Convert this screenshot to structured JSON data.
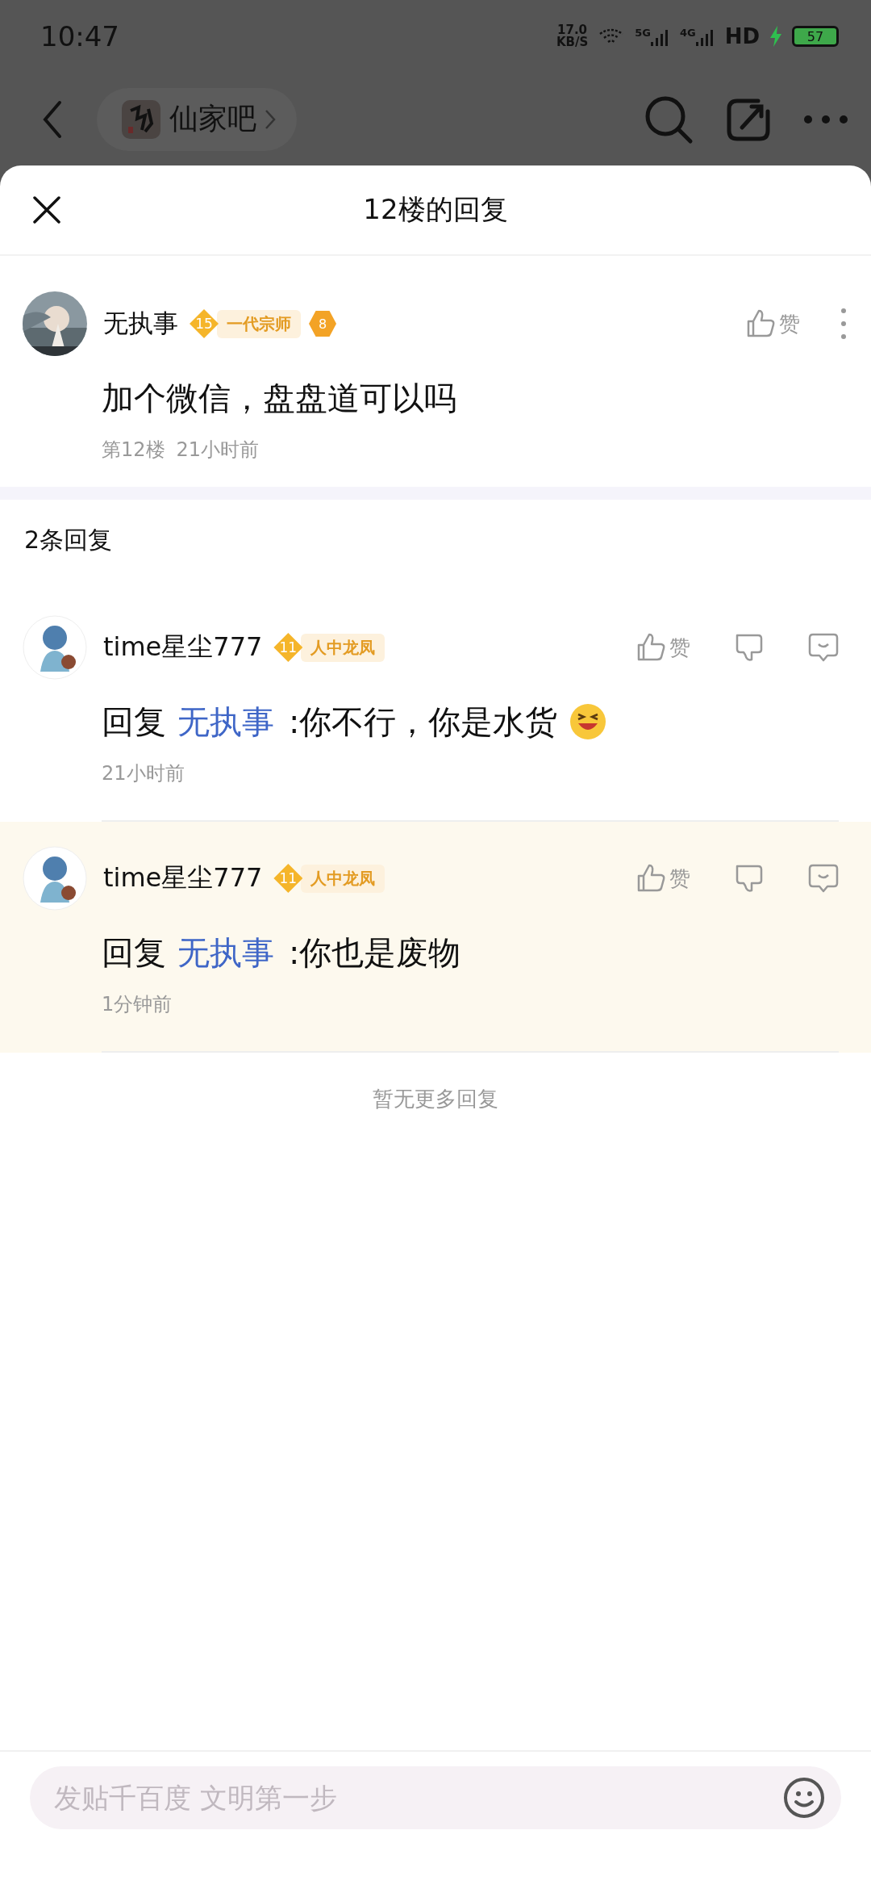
{
  "status_bar": {
    "time": "10:47",
    "net_speed": [
      "17.0",
      "KB/S"
    ],
    "signals": [
      "5G",
      "4G"
    ],
    "hd": "HD",
    "battery": "57",
    "charging": true
  },
  "nav": {
    "forum": "仙家吧"
  },
  "sheet": {
    "title": "12楼的回复"
  },
  "post": {
    "author": "无执事",
    "level": "15",
    "rank": "一代宗师",
    "badge": "8",
    "like": "赞",
    "content": "加个微信，盘盘道可以吗",
    "floor": "第12楼",
    "time": "21小时前"
  },
  "reply_count": "2条回复",
  "replies": [
    {
      "author": "time星尘777",
      "level": "11",
      "rank": "人中龙凤",
      "like": "赞",
      "prefix": "回复",
      "reply_to": "无执事",
      "text": ":你不行，你是水货",
      "emoji": true,
      "time": "21小时前",
      "highlighted": false
    },
    {
      "author": "time星尘777",
      "level": "11",
      "rank": "人中龙凤",
      "like": "赞",
      "prefix": "回复",
      "reply_to": "无执事",
      "text": ":你也是废物",
      "emoji": false,
      "time": "1分钟前",
      "highlighted": true
    }
  ],
  "end_note": "暂无更多回复",
  "composer": {
    "placeholder": "发贴千百度 文明第一步"
  }
}
